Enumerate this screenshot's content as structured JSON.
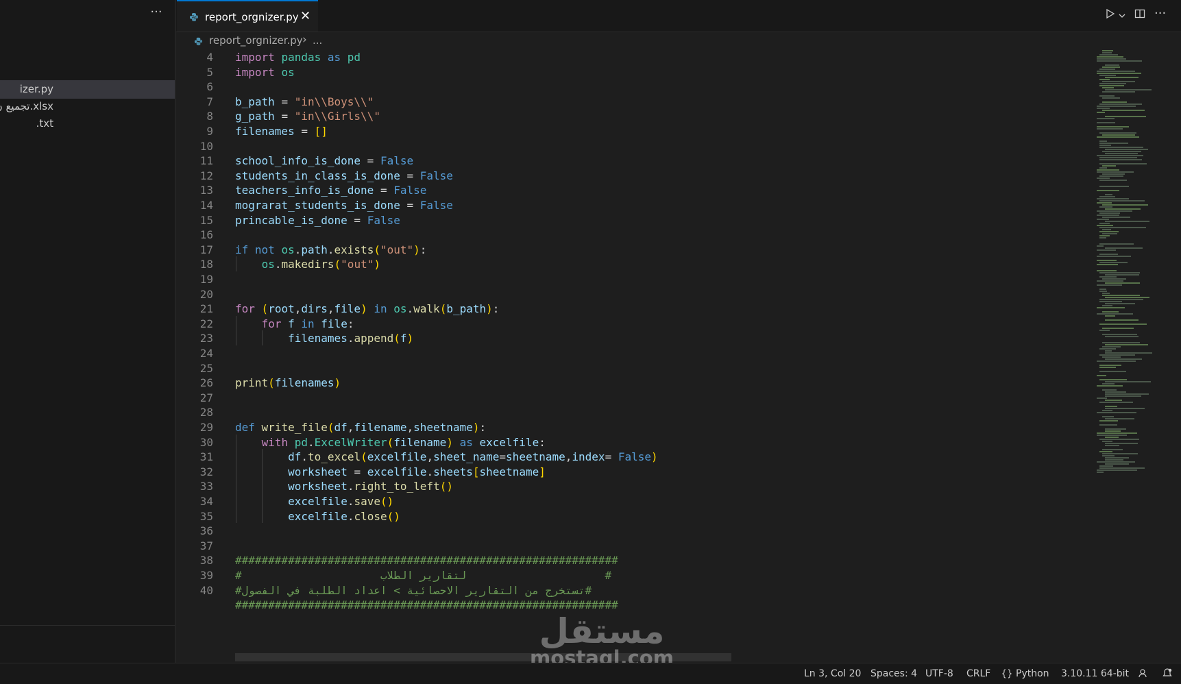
{
  "sidebar": {
    "more_label": "···",
    "files": [
      {
        "label": "izer.py",
        "active": true
      },
      {
        "label": "تجميع ن.xlsx",
        "active": false
      },
      {
        "label": ".txt",
        "active": false
      }
    ]
  },
  "tab": {
    "label": "report_orgnizer.py",
    "close": "✕"
  },
  "breadcrumb": {
    "file": "report_orgnizer.py",
    "separator": "›",
    "more": "..."
  },
  "editor_lines": [
    {
      "n": "4",
      "code": "import pandas as pd"
    },
    {
      "n": "5",
      "code": "import os"
    },
    {
      "n": "6",
      "code": ""
    },
    {
      "n": "7",
      "code": "b_path = \"in\\\\Boys\\\\\""
    },
    {
      "n": "8",
      "code": "g_path = \"in\\\\Girls\\\\\""
    },
    {
      "n": "9",
      "code": "filenames = []"
    },
    {
      "n": "10",
      "code": ""
    },
    {
      "n": "11",
      "code": "school_info_is_done = False"
    },
    {
      "n": "12",
      "code": "students_in_class_is_done = False"
    },
    {
      "n": "13",
      "code": "teachers_info_is_done = False"
    },
    {
      "n": "14",
      "code": "mograrat_students_is_done = False"
    },
    {
      "n": "15",
      "code": "princable_is_done = False"
    },
    {
      "n": "16",
      "code": ""
    },
    {
      "n": "17",
      "code": "if not os.path.exists(\"out\"):"
    },
    {
      "n": "18",
      "code": "    os.makedirs(\"out\")"
    },
    {
      "n": "19",
      "code": ""
    },
    {
      "n": "20",
      "code": ""
    },
    {
      "n": "21",
      "code": "for (root,dirs,file) in os.walk(b_path):"
    },
    {
      "n": "22",
      "code": "    for f in file:"
    },
    {
      "n": "23",
      "code": "        filenames.append(f)"
    },
    {
      "n": "24",
      "code": ""
    },
    {
      "n": "25",
      "code": ""
    },
    {
      "n": "26",
      "code": "print(filenames)"
    },
    {
      "n": "27",
      "code": ""
    },
    {
      "n": "28",
      "code": ""
    },
    {
      "n": "29",
      "code": "def write_file(df,filename,sheetname):"
    },
    {
      "n": "30",
      "code": "    with pd.ExcelWriter(filename) as excelfile:"
    },
    {
      "n": "31",
      "code": "        df.to_excel(excelfile,sheet_name=sheetname,index= False)"
    },
    {
      "n": "32",
      "code": "        worksheet = excelfile.sheets[sheetname]"
    },
    {
      "n": "33",
      "code": "        worksheet.right_to_left()"
    },
    {
      "n": "34",
      "code": "        excelfile.save()"
    },
    {
      "n": "35",
      "code": "        excelfile.close()"
    },
    {
      "n": "36",
      "code": ""
    },
    {
      "n": "37",
      "code": ""
    },
    {
      "n": "38",
      "code": "##########################################################"
    },
    {
      "n": "39",
      "code": "#                     لتقارير الطلاب                     #"
    },
    {
      "n": "40",
      "code": "#تستخرج من التقارير الاحصائية > اعداد الطلبة في الفصول#"
    }
  ],
  "status": {
    "position": "Ln 3, Col 20",
    "spaces": "Spaces: 4",
    "encoding": "UTF-8",
    "eol": "CRLF",
    "language": "Python",
    "interpreter": "3.10.11 64-bit"
  },
  "watermark": {
    "ar": "مستقل",
    "en": "mostaql.com"
  },
  "colors": {
    "accent": "#0078d4",
    "background": "#1e1e1e",
    "sidebar": "#181818"
  }
}
